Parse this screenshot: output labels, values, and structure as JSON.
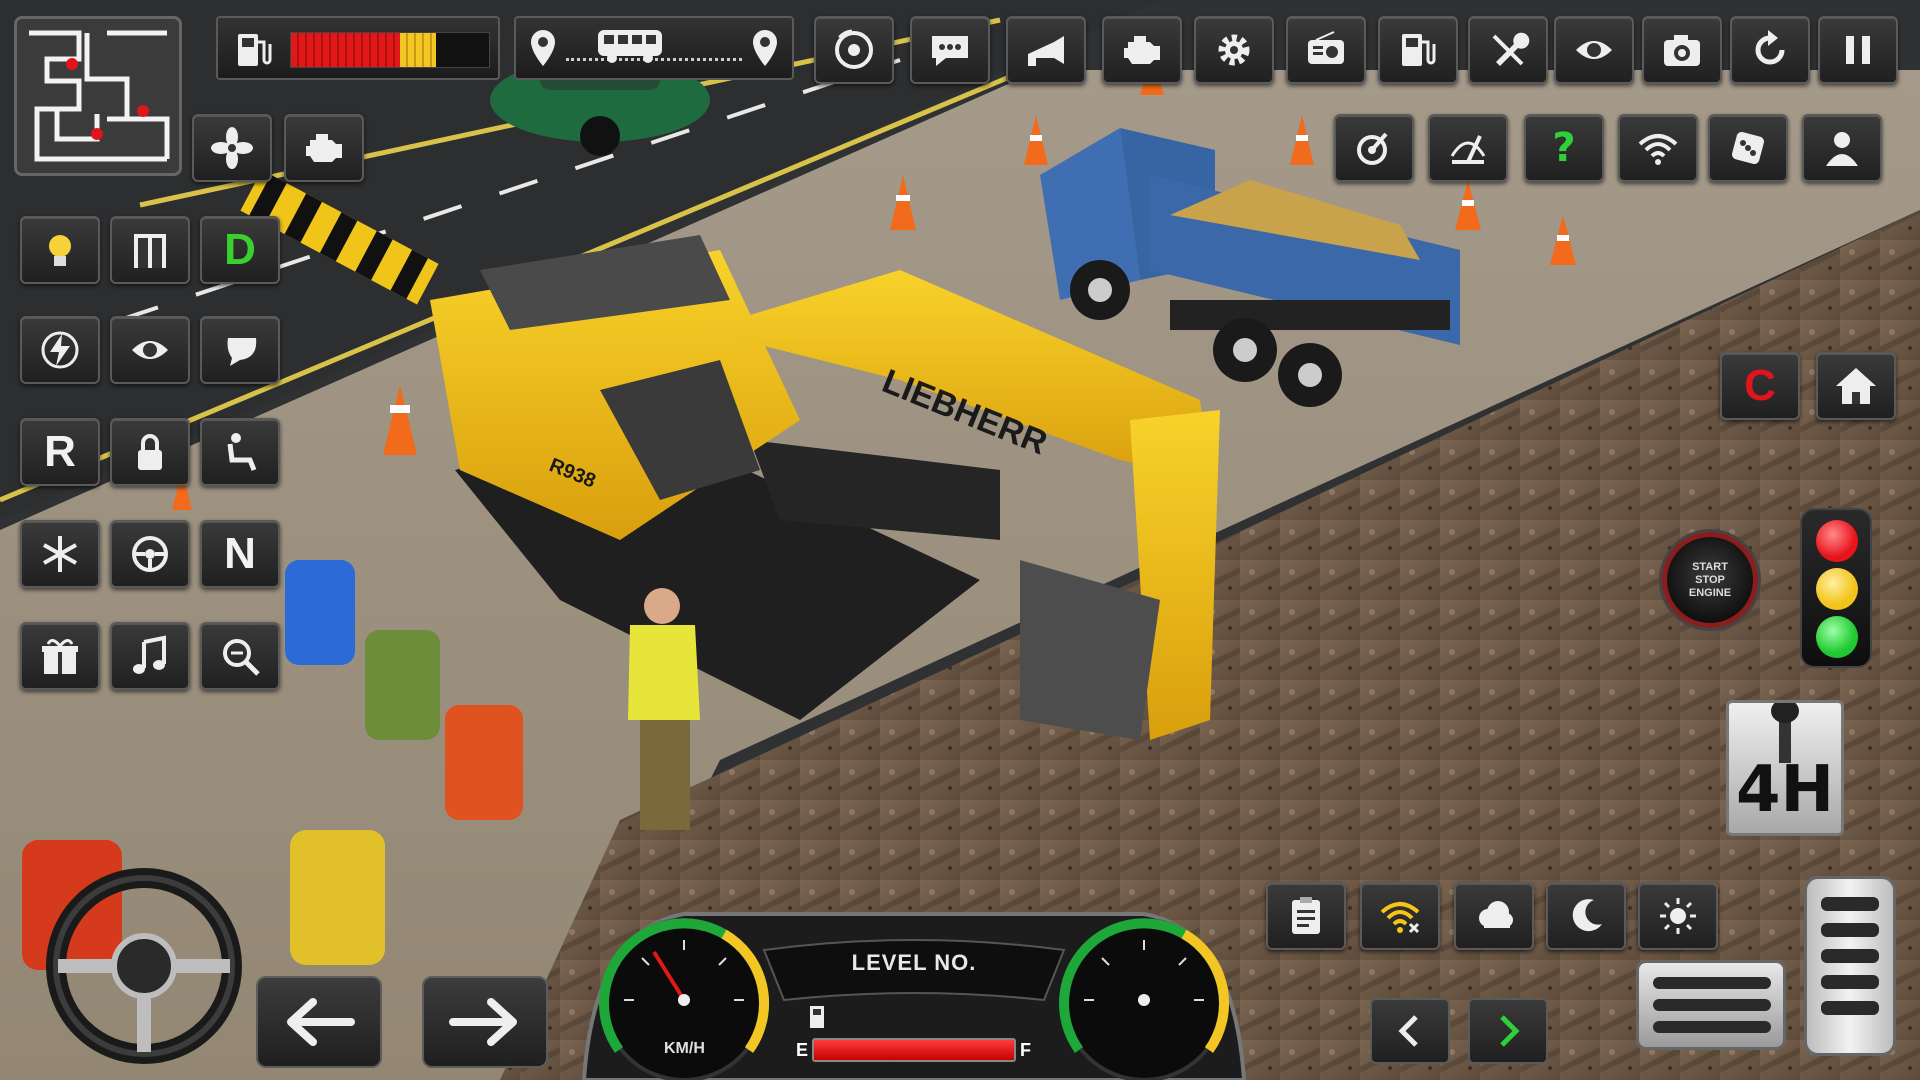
{
  "game": {
    "vehicle_brand": "LIEBHERR",
    "vehicle_model": "R938"
  },
  "top_bar": {
    "fuel_gauge": {
      "icon": "fuel-pump-icon",
      "level_red": 0.55,
      "level_yellow": 0.18
    },
    "route_progress": {
      "start_icon": "location-pin-icon",
      "vehicle_icon": "bus-icon",
      "end_icon": "location-pin-icon"
    },
    "buttons": [
      {
        "name": "brake-disc-button",
        "icon": "brake-disc-icon"
      },
      {
        "name": "chat-button",
        "icon": "speech-bubble-icon"
      },
      {
        "name": "horn-button",
        "icon": "horn-icon"
      },
      {
        "name": "engine-button",
        "icon": "engine-icon"
      },
      {
        "name": "settings-button",
        "icon": "gear-icon"
      },
      {
        "name": "radio-button",
        "icon": "radio-icon"
      },
      {
        "name": "refuel-button",
        "icon": "fuel-pump-icon"
      },
      {
        "name": "repair-button",
        "icon": "wrench-icon"
      },
      {
        "name": "camera-view-button",
        "icon": "eye-icon"
      },
      {
        "name": "screenshot-button",
        "icon": "camera-icon"
      },
      {
        "name": "restart-button",
        "icon": "restart-icon"
      },
      {
        "name": "pause-button",
        "icon": "pause-icon"
      }
    ]
  },
  "second_row": {
    "buttons": [
      {
        "name": "turbo-button",
        "icon": "turbo-icon"
      },
      {
        "name": "wiper-button",
        "icon": "wiper-icon"
      },
      {
        "name": "help-button",
        "icon": "question-icon",
        "label": "?"
      },
      {
        "name": "wifi-button",
        "icon": "wifi-icon"
      },
      {
        "name": "dice-button",
        "icon": "dice-icon"
      },
      {
        "name": "profile-button",
        "icon": "person-icon"
      }
    ]
  },
  "left_panel": {
    "rows": [
      [
        {
          "name": "fan-button",
          "icon": "fan-icon"
        },
        {
          "name": "engine-check-button",
          "icon": "engine-icon"
        }
      ],
      [
        {
          "name": "headlight-button",
          "icon": "bulb-icon"
        },
        {
          "name": "door-button",
          "icon": "door-icon"
        },
        {
          "name": "gear-drive-button",
          "label": "D",
          "style": "green-letter"
        }
      ],
      [
        {
          "name": "power-button",
          "icon": "lightning-icon"
        },
        {
          "name": "view-button",
          "icon": "eye-icon"
        },
        {
          "name": "mirror-button",
          "icon": "mirror-icon"
        }
      ],
      [
        {
          "name": "gear-reverse-button",
          "label": "R"
        },
        {
          "name": "lock-button",
          "icon": "lock-icon"
        },
        {
          "name": "seat-button",
          "icon": "seat-icon"
        }
      ],
      [
        {
          "name": "ac-button",
          "icon": "snowflake-icon"
        },
        {
          "name": "steering-mode-button",
          "icon": "steering-icon"
        },
        {
          "name": "gear-neutral-button",
          "label": "N"
        }
      ],
      [
        {
          "name": "gift-button",
          "icon": "gift-icon"
        },
        {
          "name": "music-button",
          "icon": "music-icon"
        },
        {
          "name": "zoom-button",
          "icon": "zoom-icon"
        }
      ]
    ]
  },
  "right_panel": {
    "camera_button_label": "C",
    "home_icon": "home-icon",
    "start_stop": {
      "line1": "START",
      "line2": "STOP",
      "line3": "ENGINE"
    },
    "traffic_light": {
      "red": "#e8141c",
      "yellow": "#f2c31b",
      "green": "#20c930"
    },
    "gear_shifter_label": "4H"
  },
  "bottom_bar": {
    "weather_buttons": [
      {
        "name": "clipboard-button",
        "icon": "clipboard-icon"
      },
      {
        "name": "signal-button",
        "icon": "wifi-off-icon"
      },
      {
        "name": "cloud-button",
        "icon": "cloud-icon"
      },
      {
        "name": "night-button",
        "icon": "moon-icon"
      },
      {
        "name": "day-button",
        "icon": "sun-icon"
      }
    ],
    "nav_prev_icon": "chevron-left-icon",
    "nav_next_icon": "chevron-right-icon"
  },
  "dashboard": {
    "level_label": "LEVEL NO.",
    "speed_unit": "KM/H",
    "fuel_empty": "E",
    "fuel_full": "F",
    "fuel_level": 1.0
  },
  "controls": {
    "steer_left_icon": "arrow-left-icon",
    "steer_right_icon": "arrow-right-icon"
  },
  "colors": {
    "accent_yellow": "#f5c518",
    "hud_bg": "#262626",
    "hud_border": "#5a5a5a",
    "truck_blue": "#3f6fb2"
  }
}
